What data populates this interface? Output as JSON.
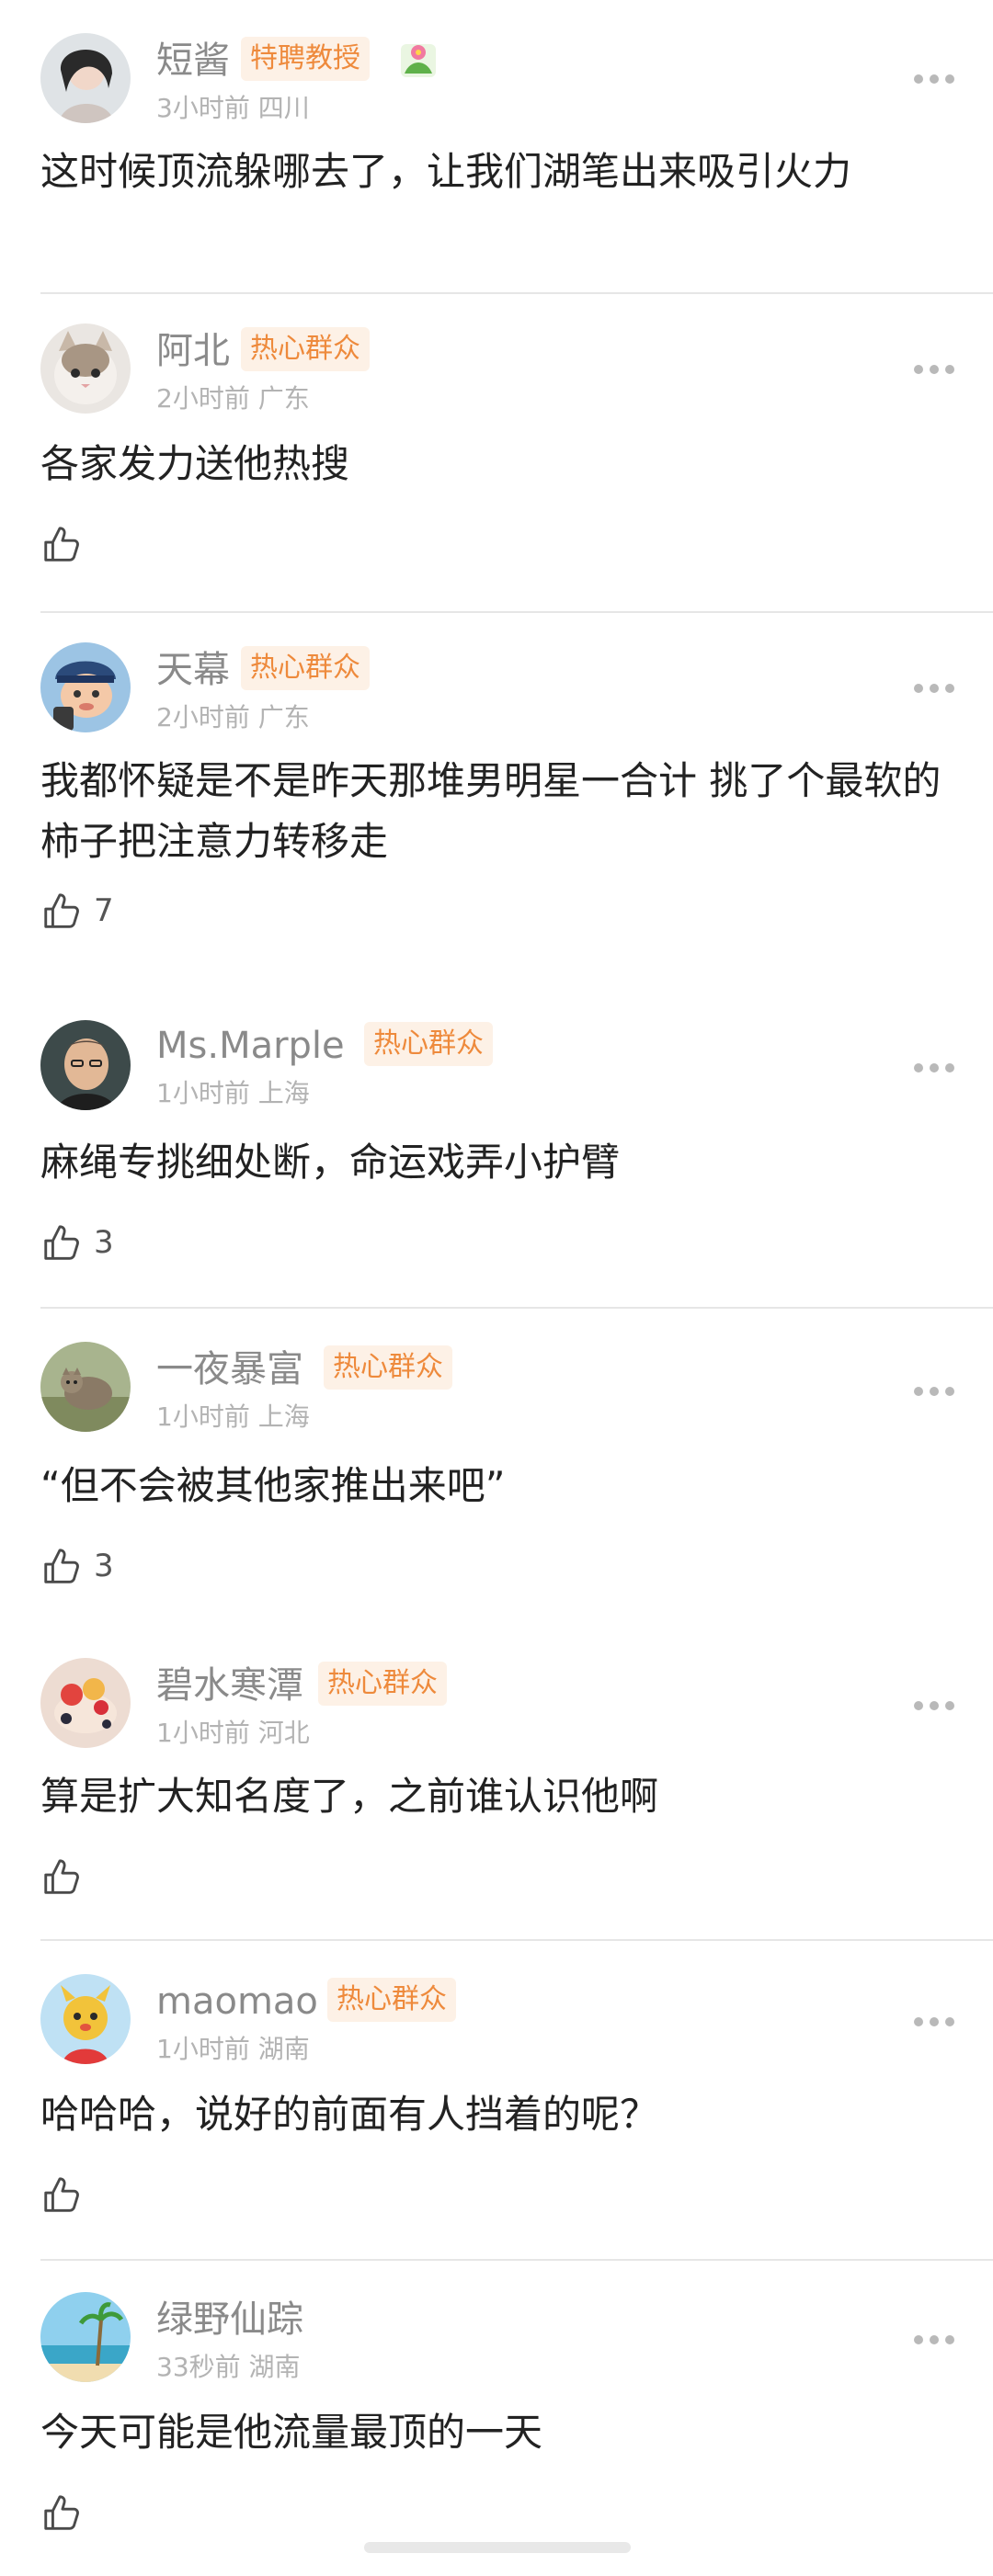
{
  "comments": [
    {
      "name": "短酱",
      "badge": "特聘教授",
      "time": "3小时前",
      "location": "四川",
      "text": "这时候顶流躲哪去了，让我们湖笔出来吸引火力",
      "likes": "",
      "show_like": false
    },
    {
      "name": "阿北",
      "badge": "热心群众",
      "time": "2小时前",
      "location": "广东",
      "text": "各家发力送他热搜",
      "likes": "",
      "show_like": true
    },
    {
      "name": "天幕",
      "badge": "热心群众",
      "time": "2小时前",
      "location": "广东",
      "text": "我都怀疑是不是昨天那堆男明星一合计 挑了个最软的柿子把注意力转移走",
      "likes": "7",
      "show_like": true
    },
    {
      "name": "Ms.Marple",
      "badge": "热心群众",
      "time": "1小时前",
      "location": "上海",
      "text": "麻绳专挑细处断，命运戏弄小护臂",
      "likes": "3",
      "show_like": true
    },
    {
      "name": "一夜暴富",
      "badge": "热心群众",
      "time": "1小时前",
      "location": "上海",
      "text": "“但不会被其他家推出来吧”",
      "likes": "3",
      "show_like": true
    },
    {
      "name": "碧水寒潭",
      "badge": "热心群众",
      "time": "1小时前",
      "location": "河北",
      "text": "算是扩大知名度了，之前谁认识他啊",
      "likes": "",
      "show_like": true
    },
    {
      "name": "maomao",
      "badge": "热心群众",
      "time": "1小时前",
      "location": "湖南",
      "text": "哈哈哈，说好的前面有人挡着的呢？",
      "likes": "",
      "show_like": true
    },
    {
      "name": "绿野仙踪",
      "badge": "",
      "time": "33秒前",
      "location": "湖南",
      "text": "今天可能是他流量最顶的一天",
      "likes": "",
      "show_like": true
    }
  ],
  "icons": {
    "like": "thumbs-up-icon",
    "more": "more-dots-icon",
    "flower": "flower-icon"
  },
  "colors": {
    "badge_bg": "#fdf1e6",
    "badge_text": "#ee8a3c",
    "username": "#8a8a8a",
    "meta": "#b3b3b3",
    "divider": "#e6e6e6"
  }
}
